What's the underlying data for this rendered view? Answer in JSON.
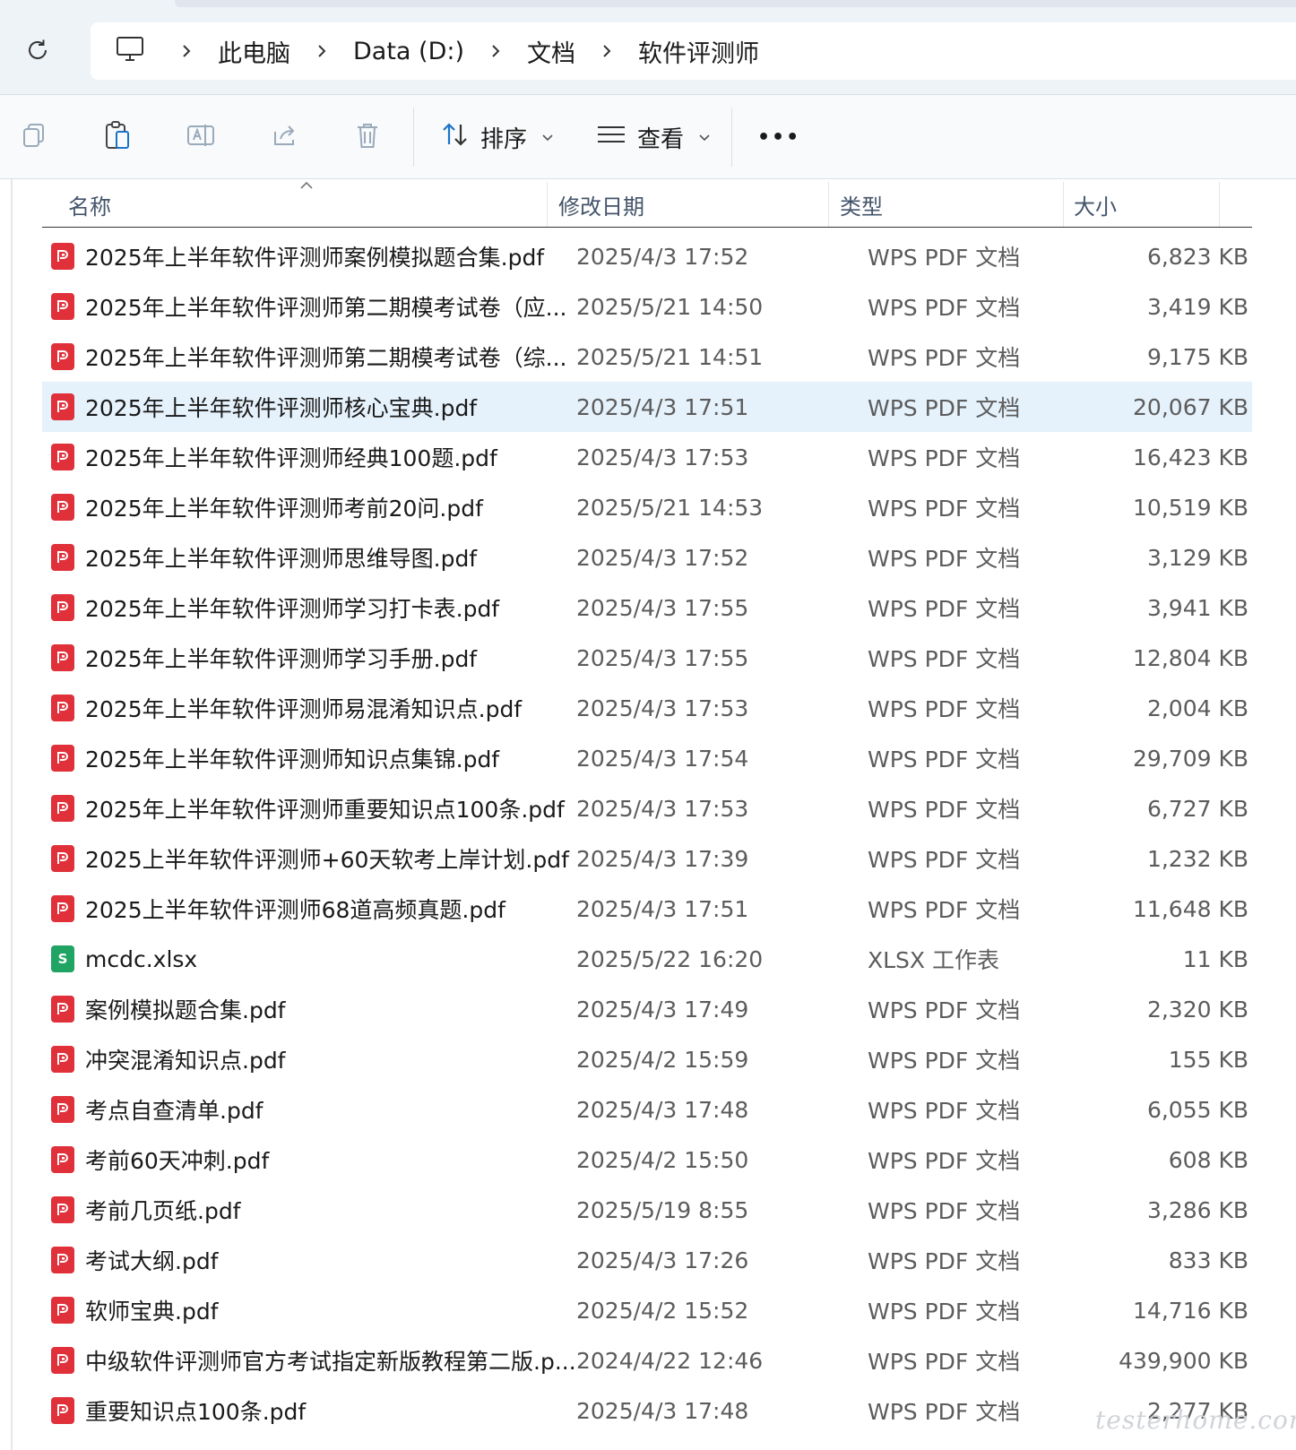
{
  "breadcrumb": {
    "items": [
      "此电脑",
      "Data (D:)",
      "文档",
      "软件评测师"
    ]
  },
  "commandbar": {
    "sort_label": "排序",
    "view_label": "查看",
    "more_label": "•••"
  },
  "columns": {
    "name": "名称",
    "date": "修改日期",
    "type": "类型",
    "size": "大小"
  },
  "files": [
    {
      "name": "2025年上半年软件评测师案例模拟题合集.pdf",
      "date": "2025/4/3 17:52",
      "type": "WPS PDF 文档",
      "size": "6,823 KB",
      "kind": "pdf"
    },
    {
      "name": "2025年上半年软件评测师第二期模考试卷（应...",
      "date": "2025/5/21 14:50",
      "type": "WPS PDF 文档",
      "size": "3,419 KB",
      "kind": "pdf"
    },
    {
      "name": "2025年上半年软件评测师第二期模考试卷（综...",
      "date": "2025/5/21 14:51",
      "type": "WPS PDF 文档",
      "size": "9,175 KB",
      "kind": "pdf"
    },
    {
      "name": "2025年上半年软件评测师核心宝典.pdf",
      "date": "2025/4/3 17:51",
      "type": "WPS PDF 文档",
      "size": "20,067 KB",
      "kind": "pdf",
      "selected": true
    },
    {
      "name": "2025年上半年软件评测师经典100题.pdf",
      "date": "2025/4/3 17:53",
      "type": "WPS PDF 文档",
      "size": "16,423 KB",
      "kind": "pdf"
    },
    {
      "name": "2025年上半年软件评测师考前20问.pdf",
      "date": "2025/5/21 14:53",
      "type": "WPS PDF 文档",
      "size": "10,519 KB",
      "kind": "pdf"
    },
    {
      "name": "2025年上半年软件评测师思维导图.pdf",
      "date": "2025/4/3 17:52",
      "type": "WPS PDF 文档",
      "size": "3,129 KB",
      "kind": "pdf"
    },
    {
      "name": "2025年上半年软件评测师学习打卡表.pdf",
      "date": "2025/4/3 17:55",
      "type": "WPS PDF 文档",
      "size": "3,941 KB",
      "kind": "pdf"
    },
    {
      "name": "2025年上半年软件评测师学习手册.pdf",
      "date": "2025/4/3 17:55",
      "type": "WPS PDF 文档",
      "size": "12,804 KB",
      "kind": "pdf"
    },
    {
      "name": "2025年上半年软件评测师易混淆知识点.pdf",
      "date": "2025/4/3 17:53",
      "type": "WPS PDF 文档",
      "size": "2,004 KB",
      "kind": "pdf"
    },
    {
      "name": "2025年上半年软件评测师知识点集锦.pdf",
      "date": "2025/4/3 17:54",
      "type": "WPS PDF 文档",
      "size": "29,709 KB",
      "kind": "pdf"
    },
    {
      "name": "2025年上半年软件评测师重要知识点100条.pdf",
      "date": "2025/4/3 17:53",
      "type": "WPS PDF 文档",
      "size": "6,727 KB",
      "kind": "pdf"
    },
    {
      "name": "2025上半年软件评测师+60天软考上岸计划.pdf",
      "date": "2025/4/3 17:39",
      "type": "WPS PDF 文档",
      "size": "1,232 KB",
      "kind": "pdf"
    },
    {
      "name": "2025上半年软件评测师68道高频真题.pdf",
      "date": "2025/4/3 17:51",
      "type": "WPS PDF 文档",
      "size": "11,648 KB",
      "kind": "pdf"
    },
    {
      "name": "mcdc.xlsx",
      "date": "2025/5/22 16:20",
      "type": "XLSX 工作表",
      "size": "11 KB",
      "kind": "xlsx"
    },
    {
      "name": "案例模拟题合集.pdf",
      "date": "2025/4/3 17:49",
      "type": "WPS PDF 文档",
      "size": "2,320 KB",
      "kind": "pdf"
    },
    {
      "name": "冲突混淆知识点.pdf",
      "date": "2025/4/2 15:59",
      "type": "WPS PDF 文档",
      "size": "155 KB",
      "kind": "pdf"
    },
    {
      "name": "考点自查清单.pdf",
      "date": "2025/4/3 17:48",
      "type": "WPS PDF 文档",
      "size": "6,055 KB",
      "kind": "pdf"
    },
    {
      "name": "考前60天冲刺.pdf",
      "date": "2025/4/2 15:50",
      "type": "WPS PDF 文档",
      "size": "608 KB",
      "kind": "pdf"
    },
    {
      "name": "考前几页纸.pdf",
      "date": "2025/5/19 8:55",
      "type": "WPS PDF 文档",
      "size": "3,286 KB",
      "kind": "pdf"
    },
    {
      "name": "考试大纲.pdf",
      "date": "2025/4/3 17:26",
      "type": "WPS PDF 文档",
      "size": "833 KB",
      "kind": "pdf"
    },
    {
      "name": "软师宝典.pdf",
      "date": "2025/4/2 15:52",
      "type": "WPS PDF 文档",
      "size": "14,716 KB",
      "kind": "pdf"
    },
    {
      "name": "中级软件评测师官方考试指定新版教程第二版.p...",
      "date": "2024/4/22 12:46",
      "type": "WPS PDF 文档",
      "size": "439,900 KB",
      "kind": "pdf"
    },
    {
      "name": "重要知识点100条.pdf",
      "date": "2025/4/3 17:48",
      "type": "WPS PDF 文档",
      "size": "2,277 KB",
      "kind": "pdf"
    }
  ],
  "xlsx_badge": "S",
  "watermark": "testerhome.com",
  "colors": {
    "pdf": "#e0303a",
    "xlsx": "#1fa463",
    "selected": "#e5f1fb"
  }
}
